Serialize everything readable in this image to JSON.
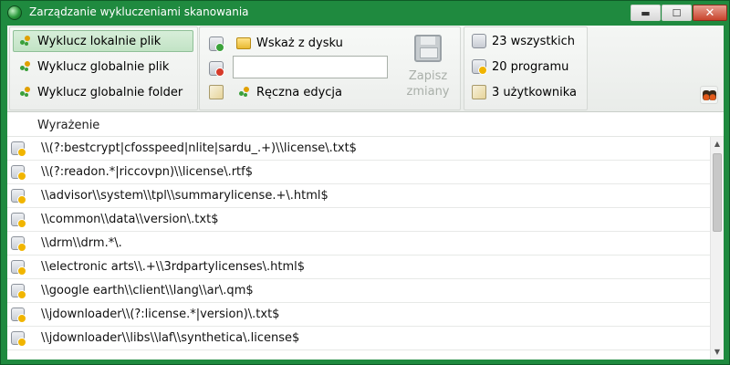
{
  "window": {
    "title": "Zarządzanie wykluczeniami skanowania",
    "controls": {
      "minimize": "▬",
      "maximize": "☐",
      "close": "✕"
    },
    "accent": "#1f8a3f"
  },
  "toolbar": {
    "exclude_group": [
      {
        "label": "Wyklucz lokalnie plik",
        "selected": true
      },
      {
        "label": "Wyklucz globalnie plik",
        "selected": false
      },
      {
        "label": "Wyklucz globalnie folder",
        "selected": false
      }
    ],
    "browse_label": "Wskaż z dysku",
    "path_value": "",
    "manual_edit_label": "Ręczna edycja",
    "save_label": "Zapisz zmiany",
    "counts": [
      {
        "label": "23 wszystkich"
      },
      {
        "label": "20 programu"
      },
      {
        "label": "3 użytkownika"
      }
    ]
  },
  "table": {
    "column_header": "Wyrażenie",
    "rows": [
      "\\\\(?:bestcrypt|cfosspeed|nlite|sardu_.+)\\\\license\\.txt$",
      "\\\\(?:readon.*|riccovpn)\\\\license\\.rtf$",
      "\\\\advisor\\\\system\\\\tpl\\\\summarylicense.+\\.html$",
      "\\\\common\\\\data\\\\version\\.txt$",
      "\\\\drm\\\\drm.*\\.",
      "\\\\electronic arts\\\\.+\\\\3rdpartylicenses\\.html$",
      "\\\\google earth\\\\client\\\\lang\\\\ar\\.qm$",
      "\\\\jdownloader\\\\(?:license.*|version)\\.txt$",
      "\\\\jdownloader\\\\libs\\\\laf\\\\synthetica\\.license$"
    ]
  }
}
